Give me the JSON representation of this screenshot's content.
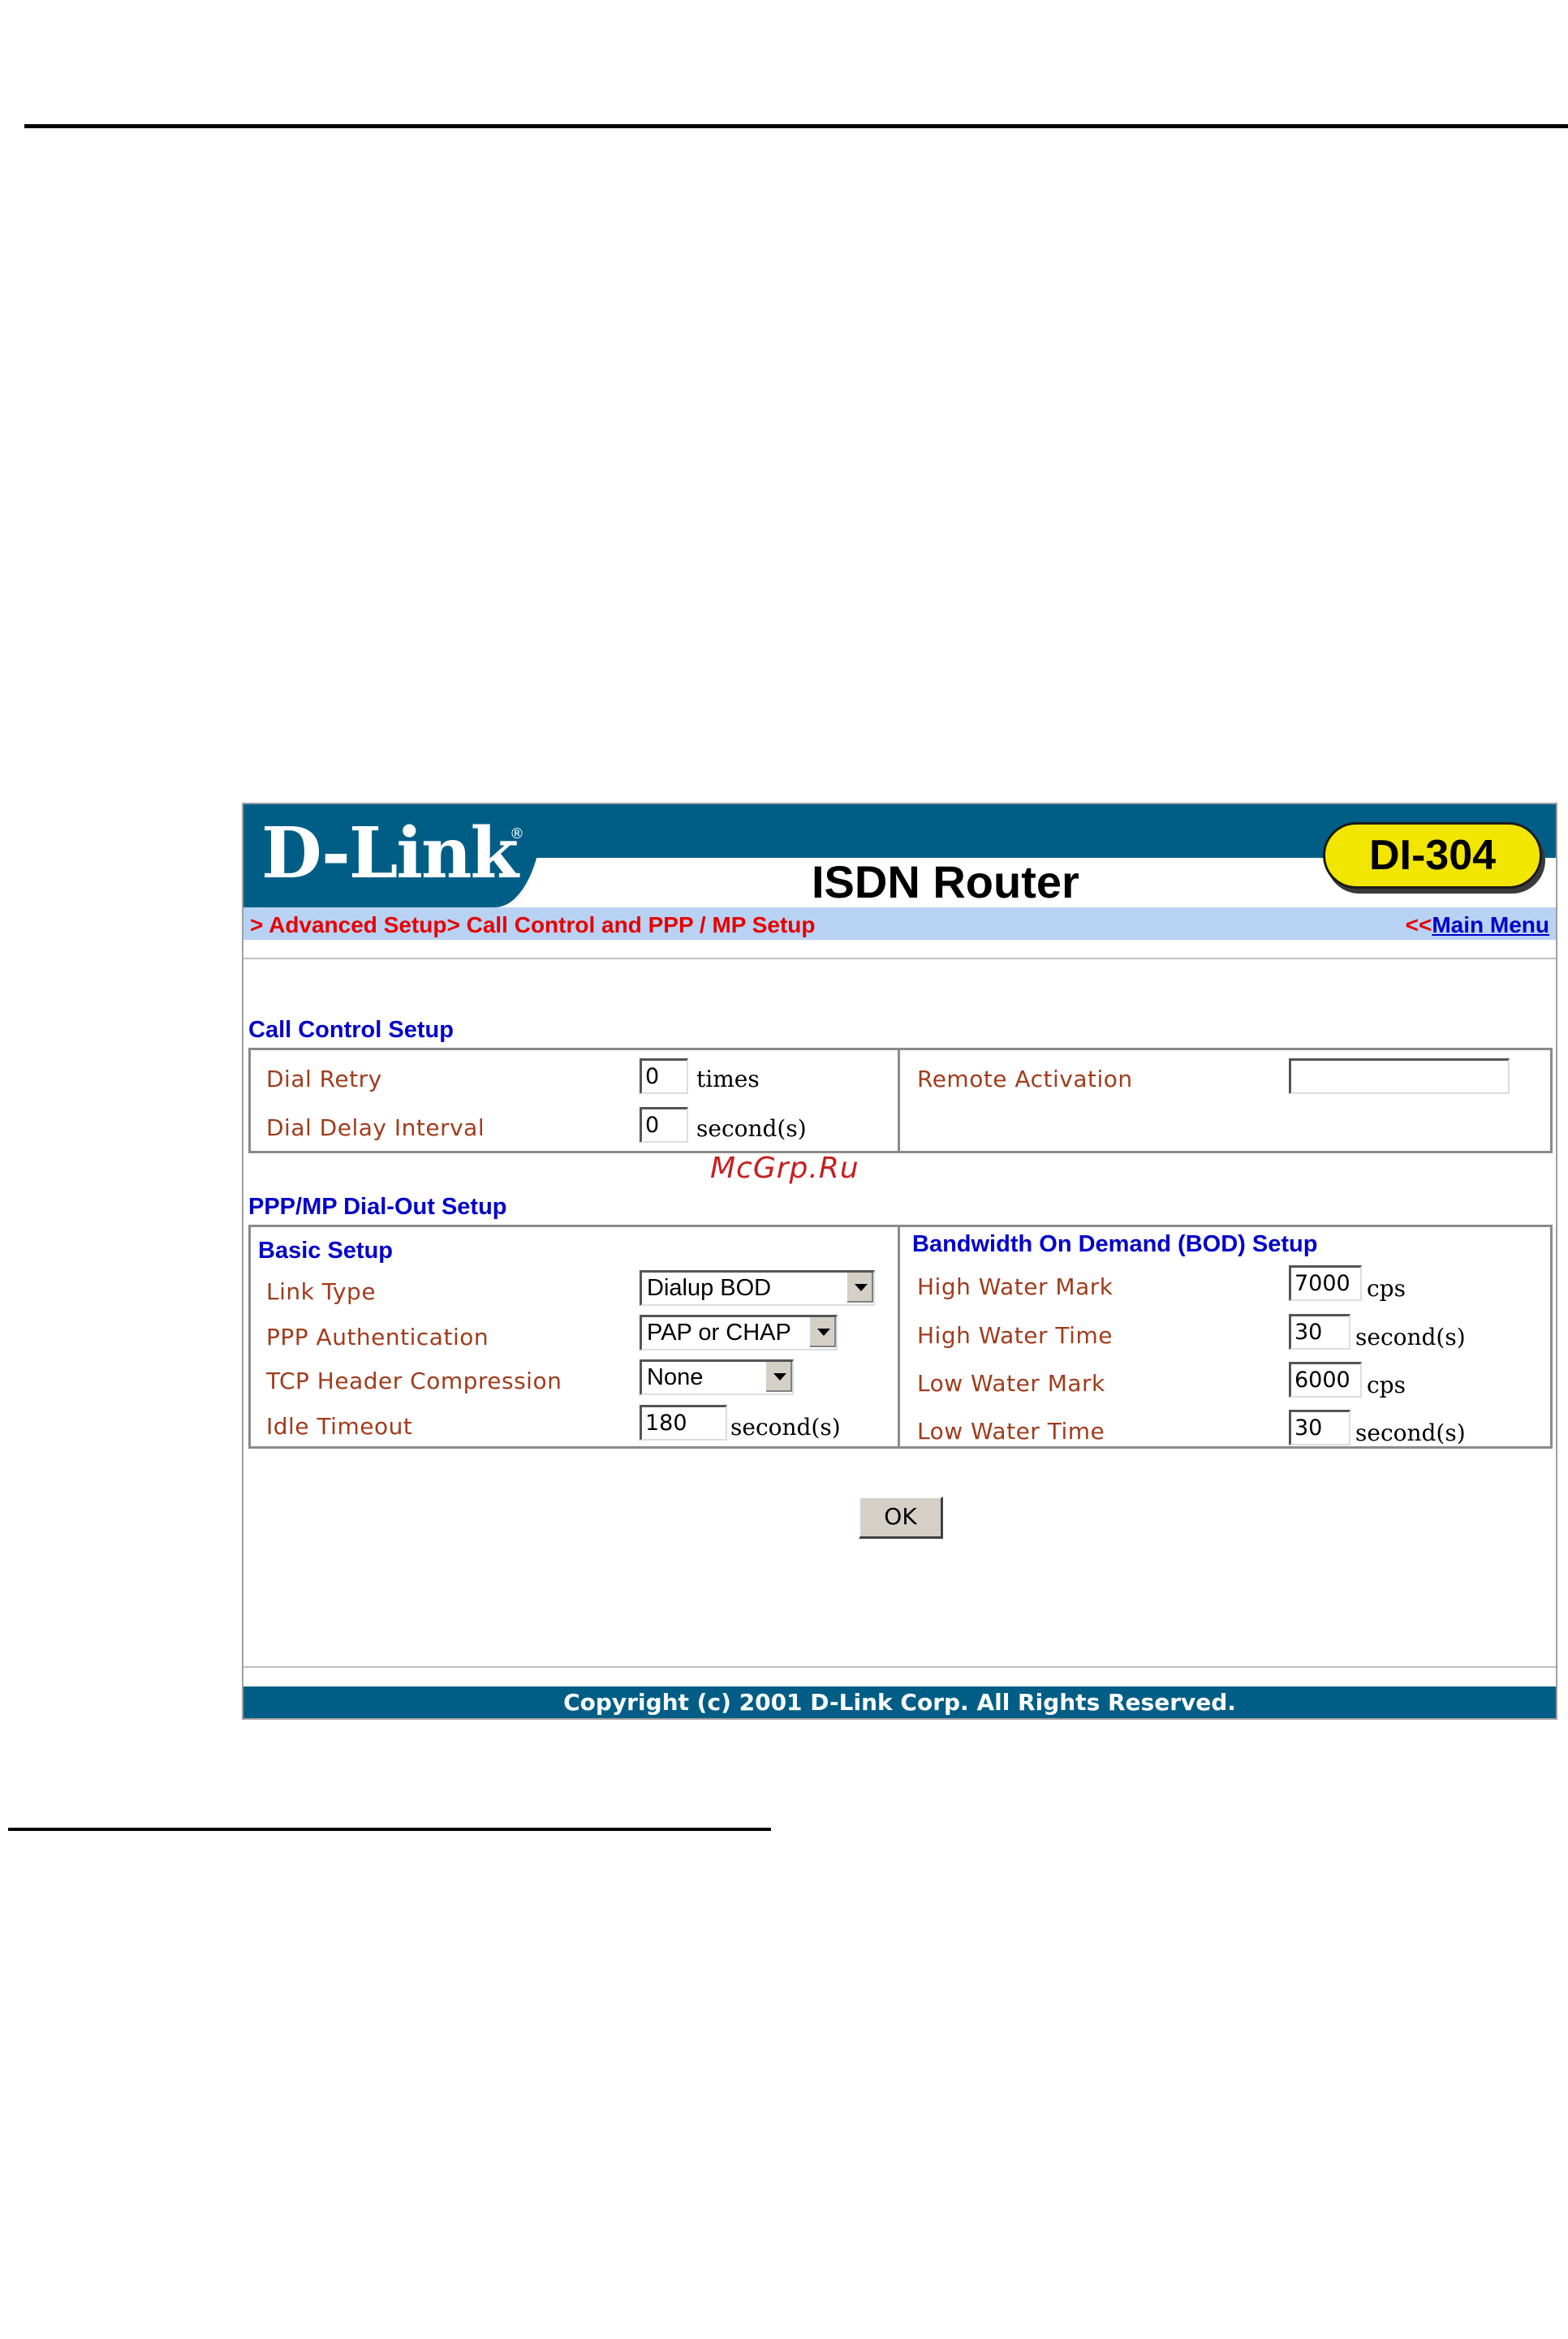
{
  "header": {
    "logo": "D-Link",
    "product_title": "ISDN Router",
    "model": "DI-304"
  },
  "breadcrumb": {
    "path": "> Advanced Setup> Call Control and PPP / MP Setup",
    "main_menu_prefix": "<<",
    "main_menu_label": "Main Menu"
  },
  "call_control": {
    "title": "Call Control Setup",
    "dial_retry": {
      "label": "Dial Retry",
      "value": "0",
      "unit": "times"
    },
    "dial_delay": {
      "label": "Dial Delay Interval",
      "value": "0",
      "unit": "second(s)"
    },
    "remote_activation": {
      "label": "Remote Activation",
      "value": ""
    }
  },
  "watermark": "McGrp.Ru",
  "ppp_mp": {
    "title": "PPP/MP Dial-Out Setup",
    "basic": {
      "title": "Basic Setup",
      "link_type": {
        "label": "Link Type",
        "value": "Dialup BOD"
      },
      "ppp_auth": {
        "label": "PPP Authentication",
        "value": "PAP or CHAP"
      },
      "tcp_compression": {
        "label": "TCP Header Compression",
        "value": "None"
      },
      "idle_timeout": {
        "label": "Idle Timeout",
        "value": "180",
        "unit": "second(s)"
      }
    },
    "bod": {
      "title": "Bandwidth On Demand (BOD) Setup",
      "high_water_mark": {
        "label": "High Water Mark",
        "value": "7000",
        "unit": "cps"
      },
      "high_water_time": {
        "label": "High Water Time",
        "value": "30",
        "unit": "second(s)"
      },
      "low_water_mark": {
        "label": "Low Water Mark",
        "value": "6000",
        "unit": "cps"
      },
      "low_water_time": {
        "label": "Low Water Time",
        "value": "30",
        "unit": "second(s)"
      }
    }
  },
  "actions": {
    "ok_label": "OK"
  },
  "footer": {
    "copyright": "Copyright (c) 2001 D-Link Corp. All Rights Reserved."
  },
  "colors": {
    "brand_blue": "#005e86",
    "badge_yellow": "#f2e600",
    "breadcrumb_bg": "#b8d2f4",
    "breadcrumb_text": "#e60000",
    "section_title": "#0000cc",
    "field_label": "#a03c1c"
  }
}
